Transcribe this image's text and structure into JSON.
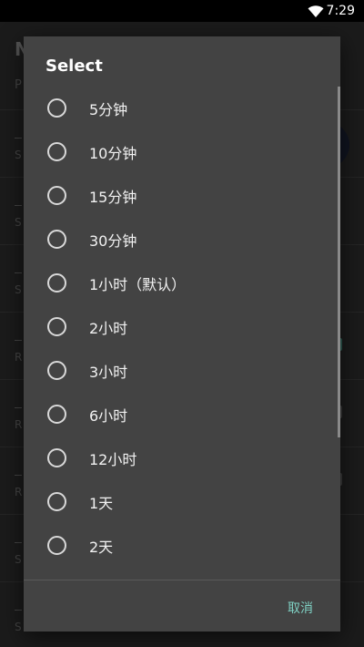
{
  "status_bar": {
    "time": "7:29"
  },
  "background": {
    "title": "N",
    "subtitle": "P",
    "rows": [
      {
        "label": "S"
      },
      {
        "label": "S"
      },
      {
        "label": "S"
      },
      {
        "label": "R"
      },
      {
        "label": "R"
      },
      {
        "label": "R"
      },
      {
        "label": "S"
      },
      {
        "label": "S"
      }
    ]
  },
  "dialog": {
    "title": "Select",
    "options": [
      {
        "label": "5分钟"
      },
      {
        "label": "10分钟"
      },
      {
        "label": "15分钟"
      },
      {
        "label": "30分钟"
      },
      {
        "label": "1小时（默认）"
      },
      {
        "label": "2小时"
      },
      {
        "label": "3小时"
      },
      {
        "label": "6小时"
      },
      {
        "label": "12小时"
      },
      {
        "label": "1天"
      },
      {
        "label": "2天"
      }
    ],
    "cancel_label": "取消"
  },
  "colors": {
    "accent": "#7fd0c3",
    "dialog_bg": "#434343"
  }
}
